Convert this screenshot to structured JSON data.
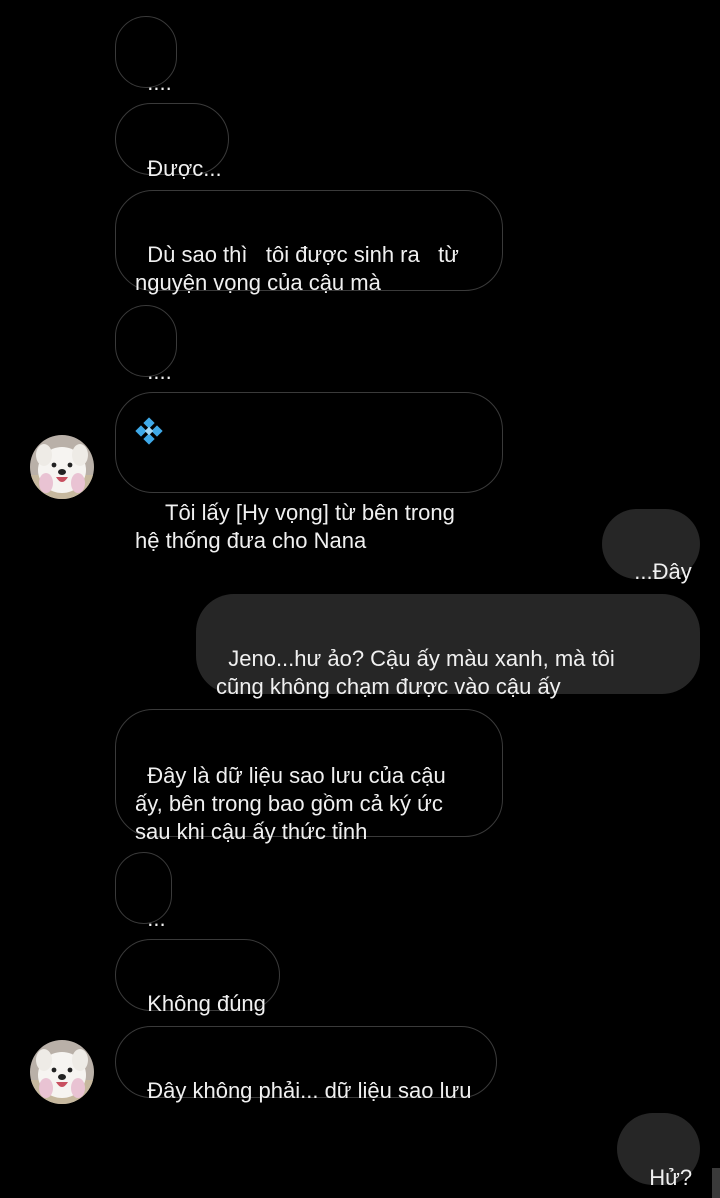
{
  "conversation": {
    "messages": [
      {
        "id": "m1",
        "side": "received",
        "text": "...."
      },
      {
        "id": "m2",
        "side": "received",
        "text": "Được..."
      },
      {
        "id": "m3",
        "side": "received",
        "text": "Dù sao thì   tôi được sinh ra   từ\nnguyện vọng của cậu mà"
      },
      {
        "id": "m4",
        "side": "received",
        "text": "...."
      },
      {
        "id": "m5",
        "side": "received",
        "text": "Tôi lấy [Hy vọng] từ bên trong\nhệ thống đưa cho Nana",
        "icon": "blue-diamond-icon"
      },
      {
        "id": "m6",
        "side": "sent",
        "text": "...Đây"
      },
      {
        "id": "m7",
        "side": "sent",
        "text": "Jeno...hư ảo? Cậu ấy màu xanh, mà tôi\ncũng không chạm được vào cậu ấy"
      },
      {
        "id": "m8",
        "side": "received",
        "text": "Đây là dữ liệu sao lưu của cậu\nấy, bên trong bao gồm cả ký ức\nsau khi cậu ấy thức tỉnh"
      },
      {
        "id": "m9",
        "side": "received",
        "text": "..."
      },
      {
        "id": "m10",
        "side": "received",
        "text": "Không đúng"
      },
      {
        "id": "m11",
        "side": "received",
        "text": "Đây không phải... dữ liệu sao lưu"
      },
      {
        "id": "m12",
        "side": "sent",
        "text": "Hử?"
      }
    ]
  },
  "avatar": {
    "icon": "dog-avatar"
  },
  "colors": {
    "background": "#000000",
    "received_border": "#3a3a3a",
    "sent_bubble": "#262626",
    "text": "#f0f0f0",
    "diamond": "#3fa9e8"
  }
}
